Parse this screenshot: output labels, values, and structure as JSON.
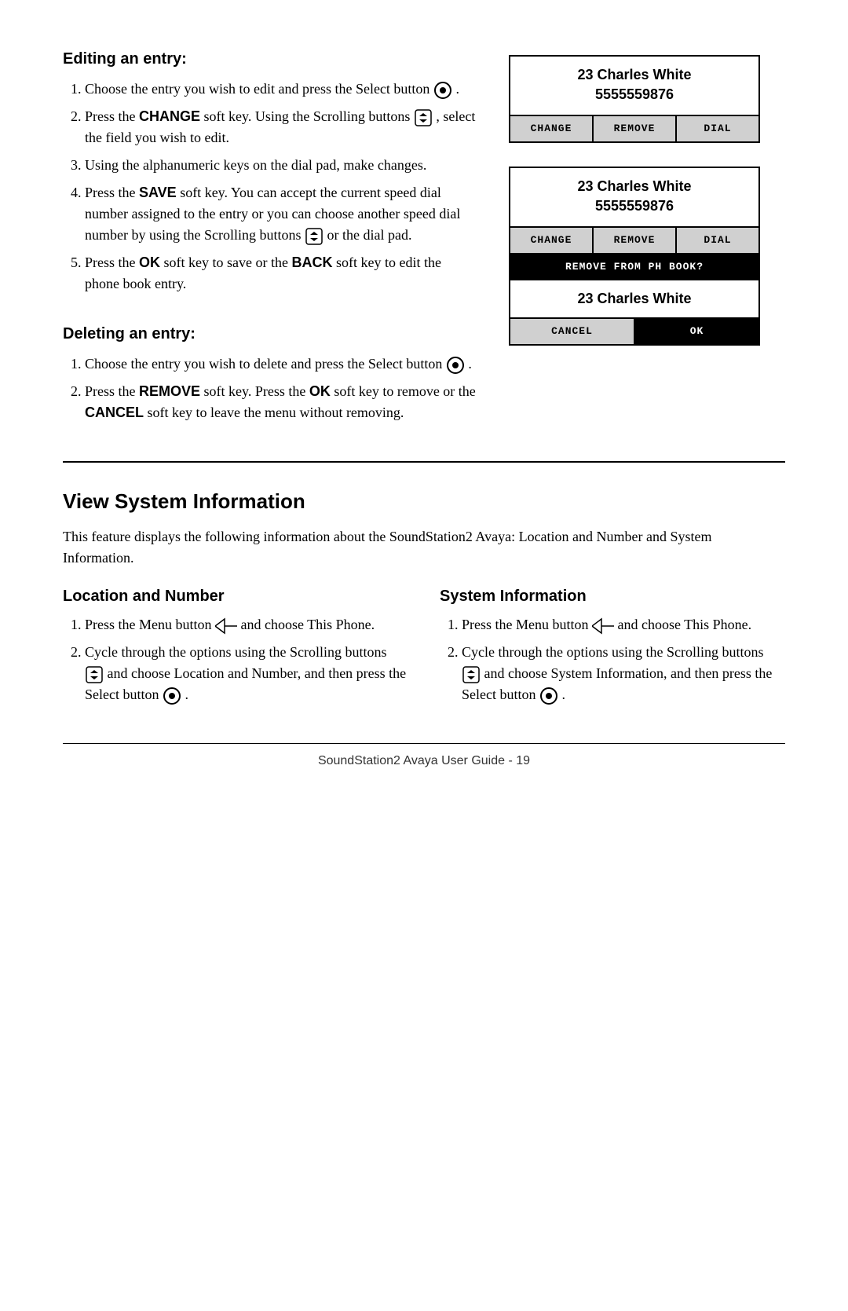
{
  "page": {
    "footer": "SoundStation2 Avaya User Guide - 19"
  },
  "editing": {
    "heading": "Editing an entry:",
    "steps": [
      "Choose the entry you wish to edit and press the Select button",
      "Press the CHANGE soft key.  Using the Scrolling buttons , select the field you wish to edit.",
      "Using the alphanumeric keys on the dial pad, make changes.",
      "Press the SAVE soft key.  You can accept the current speed dial number assigned to the entry or you can choose another speed dial number by using the Scrolling buttons  or the dial pad.",
      "Press the OK soft key to save or the BACK soft key to edit the phone book entry."
    ],
    "step2_pre": "Press the ",
    "step2_key": "CHANGE",
    "step2_post": " soft key.  Using the Scrolling buttons",
    "step2_post2": ", select the field you wish to edit.",
    "step4_pre": "Press the ",
    "step4_key": "SAVE",
    "step4_post": " soft key.  You can accept the current speed dial number assigned to the entry or you can choose another speed dial number by using the Scrolling buttons",
    "step4_post2": " or the dial pad.",
    "step5_pre": "Press the ",
    "step5_key1": "OK",
    "step5_mid": " soft key to save or the ",
    "step5_key2": "BACK",
    "step5_post": " soft key to edit the phone book entry."
  },
  "deleting": {
    "heading": "Deleting an entry:",
    "step1_pre": "Choose the entry you wish to delete and press the Select button",
    "step2_pre": "Press the ",
    "step2_key": "REMOVE",
    "step2_mid": " soft key.  Press the ",
    "step2_key2": "OK",
    "step2_mid2": " soft key to remove or the ",
    "step2_key3": "CANCEL",
    "step2_post": " soft key to leave the menu without removing."
  },
  "screen1": {
    "name": "23 Charles White",
    "number": "5555559876",
    "btn1": "CHANGE",
    "btn2": "REMOVE",
    "btn3": "DIAL"
  },
  "screen2": {
    "name": "23 Charles White",
    "number": "5555559876",
    "btn1": "CHANGE",
    "btn2": "REMOVE",
    "btn3": "DIAL",
    "confirm_label": "REMOVE FROM PH BOOK?",
    "confirm_name": "23 Charles White",
    "confirm_btn1": "CANCEL",
    "confirm_btn2": "OK"
  },
  "view_system": {
    "title": "View System Information",
    "description": "This feature displays the following information about the SoundStation2 Avaya: Location and Number and System Information.",
    "location_heading": "Location and Number",
    "location_steps": [
      "Press the Menu button  and choose This Phone.",
      "Cycle through the options using the Scrolling buttons  and choose Location and Number, and then press the Select button"
    ],
    "location_step1_pre": "Press the Menu button",
    "location_step1_post": " and choose This Phone.",
    "location_step2_pre": "Cycle through the options using the Scrolling buttons",
    "location_step2_mid": " and choose Location and Number, and then press the Select button",
    "system_heading": "System Information",
    "system_steps": [
      "Press the Menu button  and choose This Phone.",
      "Cycle through the options using the Scrolling buttons  and choose System Information, and then press the Select button"
    ],
    "system_step1_pre": "Press the Menu button",
    "system_step1_post": " and choose This Phone.",
    "system_step2_pre": "Cycle through the options using the Scrolling buttons",
    "system_step2_mid": " and choose System Information, and then press the Select button"
  }
}
